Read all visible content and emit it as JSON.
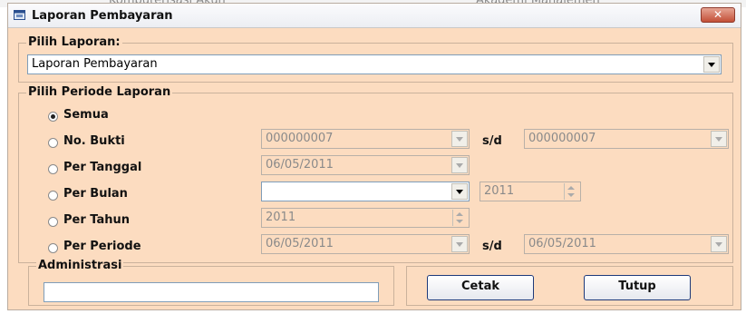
{
  "background": {
    "left_text": "Komputerisasi Akun",
    "right_text": "Akademi Manajemen"
  },
  "window": {
    "title": "Laporan Pembayaran",
    "close_glyph": "✕"
  },
  "pilih_laporan": {
    "legend": "Pilih Laporan:",
    "selected": "Laporan Pembayaran"
  },
  "periode": {
    "legend": "Pilih Periode Laporan",
    "options": [
      {
        "label": "Semua",
        "checked": true
      },
      {
        "label": "No. Bukti",
        "checked": false
      },
      {
        "label": "Per Tanggal",
        "checked": false
      },
      {
        "label": "Per Bulan",
        "checked": false
      },
      {
        "label": "Per Tahun",
        "checked": false
      },
      {
        "label": "Per Periode",
        "checked": false
      }
    ],
    "no_bukti_from": "000000007",
    "no_bukti_to": "000000007",
    "sd_label": "s/d",
    "tanggal": "06/05/2011",
    "bulan": "",
    "bulan_tahun": "2011",
    "tahun": "2011",
    "periode_from": "06/05/2011",
    "periode_to": "06/05/2011"
  },
  "administrasi": {
    "legend": "Administrasi",
    "value": ""
  },
  "buttons": {
    "cetak": "Cetak",
    "tutup": "Tutup"
  },
  "colors": {
    "form_bg": "#fcdcc0",
    "close_button": "#c34f37",
    "button_border": "#1e3a7a"
  }
}
